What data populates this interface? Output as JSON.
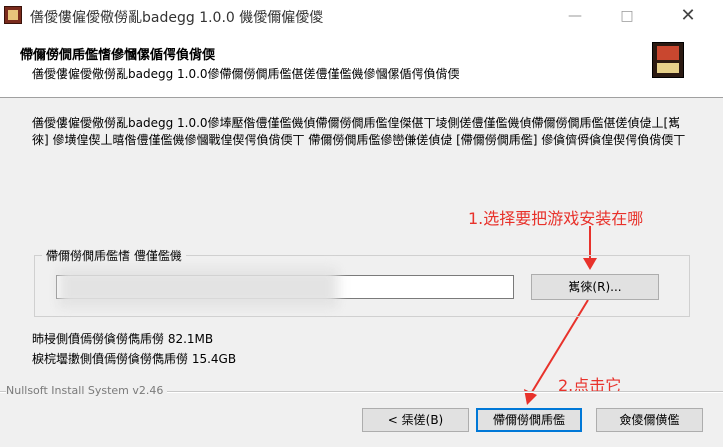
{
  "window": {
    "title": "僐僾僂僱僾儆僗亂badegg  1.0.0 僟僾儞僱僾儍",
    "minimize_icon": "minimize-icon",
    "maximize_icon": "maximize-icon",
    "close_icon": "close-icon"
  },
  "header": {
    "title": "僀儞僗僩乕儖愭傪慖傫偱偔偩偝偄",
    "subtitle": "僐僾僂僱僾儆僗亂badegg   1.0.0傪僀儞僗僩乕儖偡傞僼僅儖僟傪慖傫偱偔偩偝偄"
  },
  "description": "僐僾僂僱僾儆僗亂badegg   1.0.0傪埲壓偺僼僅儖僟偵僀儞僗僩乕儖偟傑偡丅堎側傞僼僅儖僟偵僀儞僗僩乕儖偡傞偵偼丄[嶲徠] 傪墴偟偰丄暿偺僼僅儖僟傪慖戰偟偰偔偩偝偄丅 僀儞僗僩乕儖傪巒傔傞偵偼 [僀儞僗僩乕儖] 傪僋儕僢僋偟偰偔偩偝偄丅",
  "annotations": {
    "step1": "1.选择要把游戏安装在哪",
    "step2": "2.点击它",
    "accent": "#e8322b"
  },
  "destination": {
    "group_label": "僀儞僗僩乕儖愭 僼僅儖僟",
    "path_value": "",
    "browse_label": "嶲徠(R)..."
  },
  "space": {
    "required": "昁梫側僨傿僗僋僗儁乕僗 82.1MB",
    "available": "棙梡壜擻側僨傿僗僋僗儁乕僗 15.4GB"
  },
  "footer": {
    "branding": "Nullsoft Install System v2.46",
    "back_label": "< 栠傞(B)",
    "install_label": "僀儞僗僩乕儖",
    "cancel_label": "僉儍儞僙儖"
  }
}
